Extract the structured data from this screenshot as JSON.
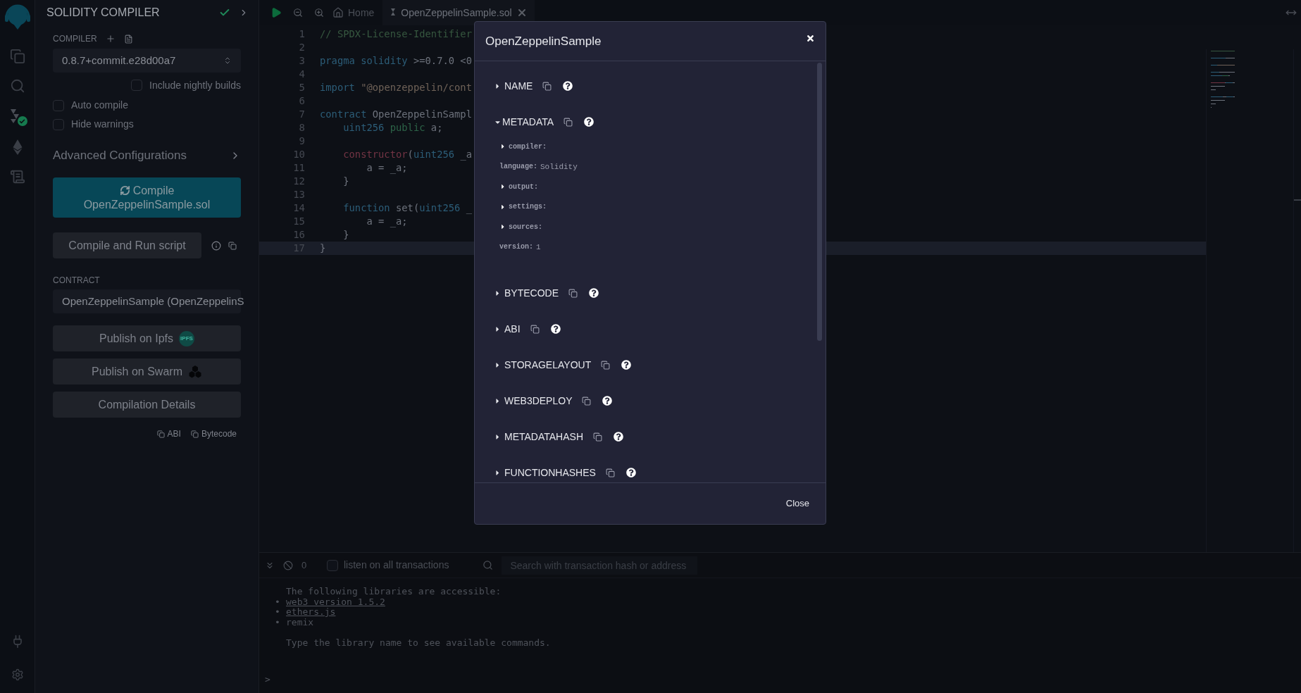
{
  "side_panel": {
    "title": "SOLIDITY COMPILER",
    "compiler_label": "COMPILER",
    "compiler_version": "0.8.7+commit.e28d00a7",
    "options": [
      {
        "label": "Include nightly builds",
        "checked": false
      },
      {
        "label": "Auto compile",
        "checked": false
      },
      {
        "label": "Hide warnings",
        "checked": false
      }
    ],
    "advanced": "Advanced Configurations",
    "compile_button": {
      "label": "Compile",
      "file": "OpenZeppelinSample.sol"
    },
    "run_script_button": "Compile and Run script",
    "contract_label": "CONTRACT",
    "contract": "OpenZeppelinSample (OpenZeppelinS",
    "publish_ipfs": "Publish on Ipfs",
    "ipfs_badge": "IPFS",
    "publish_swarm": "Publish on Swarm",
    "details_button": "Compilation Details",
    "links": [
      "ABI",
      "Bytecode"
    ]
  },
  "editor": {
    "home_tab": "Home",
    "tabs": [
      {
        "label": "OpenZeppelinSample.sol",
        "selected": true
      }
    ],
    "lines": [
      {
        "number": "1",
        "active": false,
        "tokens": [
          {
            "text": "// SPDX-License-Identifier",
            "kind": "comment"
          }
        ]
      },
      {
        "number": "2",
        "active": false
      },
      {
        "number": "3",
        "active": false,
        "tokens": [
          {
            "text": "pragma solidity ",
            "kind": "keyword"
          },
          {
            "text": ">=0.7.0 <0",
            "kind": "plain"
          }
        ]
      },
      {
        "number": "4",
        "active": false
      },
      {
        "number": "5",
        "active": false,
        "tokens": [
          {
            "text": "import ",
            "kind": "keyword"
          },
          {
            "text": "\"@openzeppelin/cont",
            "kind": "string"
          }
        ]
      },
      {
        "number": "6",
        "active": false
      },
      {
        "number": "7",
        "active": false,
        "tokens": [
          {
            "text": "contract ",
            "kind": "keyword"
          },
          {
            "text": "OpenZeppelinSampl",
            "kind": "plain"
          }
        ]
      },
      {
        "number": "8",
        "active": false,
        "tokens": [
          {
            "text": "    uint256 ",
            "kind": "keyword"
          },
          {
            "text": "public ",
            "kind": "modifier"
          },
          {
            "text": "a;",
            "kind": "plain"
          }
        ]
      },
      {
        "number": "9",
        "active": false
      },
      {
        "number": "10",
        "active": false,
        "tokens": [
          {
            "text": "    constructor",
            "kind": "special"
          },
          {
            "text": "(",
            "kind": "plain"
          },
          {
            "text": "uint256 ",
            "kind": "keyword"
          },
          {
            "text": "_a",
            "kind": "plain"
          }
        ]
      },
      {
        "number": "11",
        "active": false,
        "tokens": [
          {
            "text": "        a = _a;",
            "kind": "plain"
          }
        ]
      },
      {
        "number": "12",
        "active": false,
        "tokens": [
          {
            "text": "    }",
            "kind": "plain"
          }
        ]
      },
      {
        "number": "13",
        "active": false
      },
      {
        "number": "14",
        "active": false,
        "tokens": [
          {
            "text": "    function ",
            "kind": "keyword"
          },
          {
            "text": "set(",
            "kind": "plain"
          },
          {
            "text": "uint256 ",
            "kind": "keyword"
          },
          {
            "text": "_",
            "kind": "plain"
          }
        ]
      },
      {
        "number": "15",
        "active": false,
        "tokens": [
          {
            "text": "        a = _a;",
            "kind": "plain"
          }
        ]
      },
      {
        "number": "16",
        "active": false,
        "tokens": [
          {
            "text": "    }",
            "kind": "plain"
          }
        ]
      },
      {
        "number": "17",
        "active": true,
        "tokens": [
          {
            "text": "}",
            "kind": "plain"
          }
        ]
      }
    ]
  },
  "terminal": {
    "count": "0",
    "listen": {
      "label": "listen on all transactions",
      "checked": false
    },
    "search_placeholder": "Search with transaction hash or address",
    "lines": [
      {
        "kind": "text",
        "text": "The following libraries are accessible:"
      },
      {
        "kind": "link",
        "bullet": "•",
        "text": "web3 version 1.5.2"
      },
      {
        "kind": "link",
        "bullet": "•",
        "text": "ethers.js"
      },
      {
        "kind": "item",
        "bullet": "•",
        "text": "remix"
      },
      {
        "kind": "gap"
      },
      {
        "kind": "text",
        "text": "Type the library name to see available commands."
      }
    ],
    "prompt": ">"
  },
  "modal": {
    "title": "OpenZeppelinSample",
    "items": [
      {
        "label": "NAME",
        "expanded": false
      },
      {
        "label": "METADATA",
        "expanded": true,
        "children": [
          {
            "kind": "branch",
            "key": "compiler:",
            "expanded": false
          },
          {
            "kind": "leaf",
            "key": "language:",
            "value": "Solidity"
          },
          {
            "kind": "branch",
            "key": "output:",
            "expanded": false
          },
          {
            "kind": "branch",
            "key": "settings:",
            "expanded": false
          },
          {
            "kind": "branch",
            "key": "sources:",
            "expanded": false
          },
          {
            "kind": "leaf",
            "key": "version:",
            "value": "1"
          }
        ]
      },
      {
        "label": "BYTECODE",
        "expanded": false
      },
      {
        "label": "ABI",
        "expanded": false
      },
      {
        "label": "STORAGELAYOUT",
        "expanded": false
      },
      {
        "label": "WEB3DEPLOY",
        "expanded": false
      },
      {
        "label": "METADATAHASH",
        "expanded": false
      },
      {
        "label": "FUNCTIONHASHES",
        "expanded": false
      }
    ],
    "close_button": "Close"
  }
}
